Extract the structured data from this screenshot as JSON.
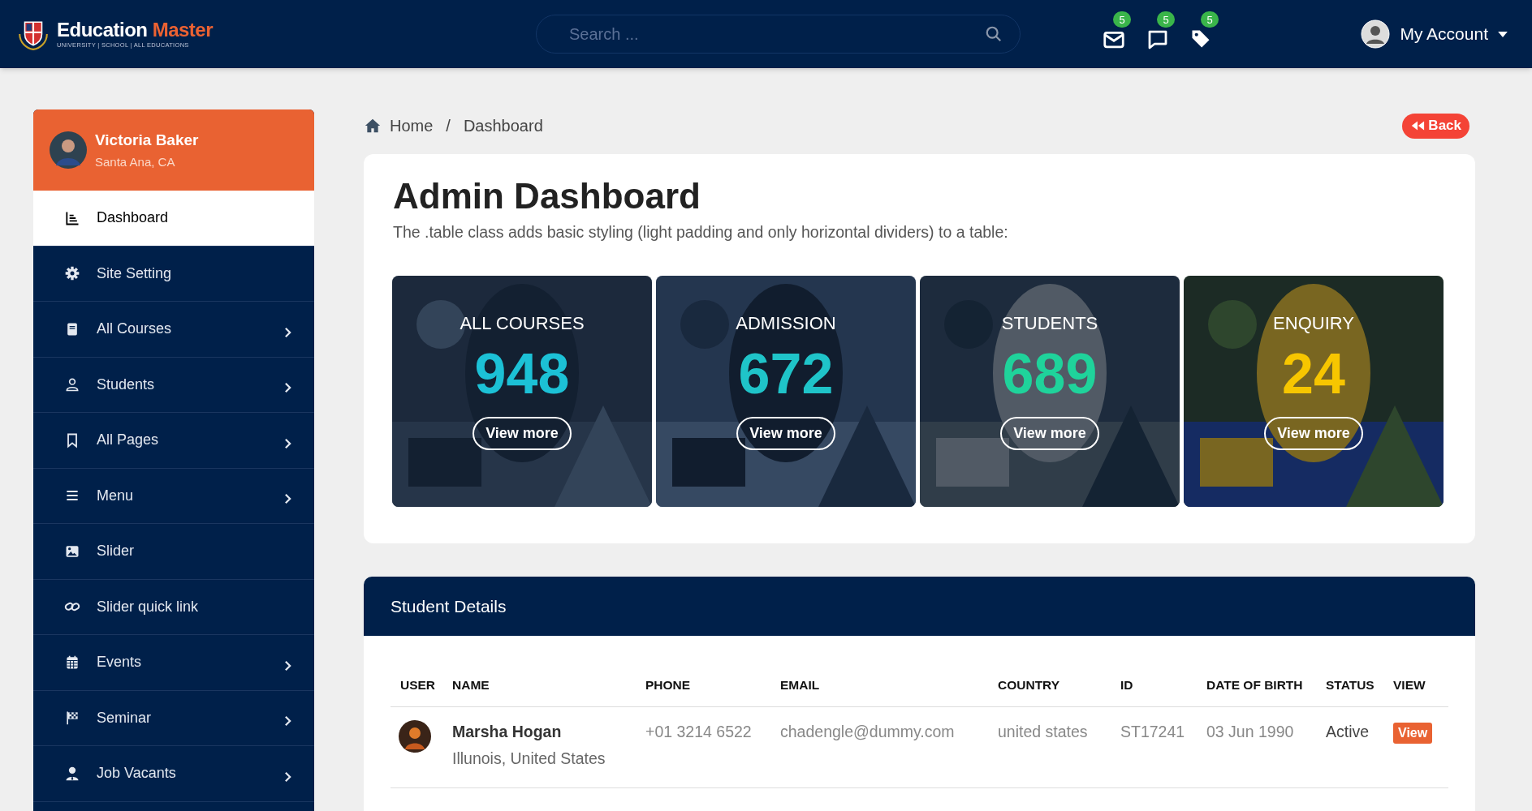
{
  "header": {
    "logo": {
      "name_part1": "Education",
      "name_part2": "Master",
      "tagline": "UNIVERSITY | SCHOOL | ALL EDUCATIONS"
    },
    "search": {
      "placeholder": "Search ..."
    },
    "notifications": [
      {
        "count": "5"
      },
      {
        "count": "5"
      },
      {
        "count": "5"
      }
    ],
    "account": {
      "label": "My Account"
    }
  },
  "sidebar": {
    "profile": {
      "name": "Victoria Baker",
      "location": "Santa Ana, CA"
    },
    "items": [
      {
        "label": "Dashboard",
        "selected": true,
        "has_children": false
      },
      {
        "label": "Site Setting",
        "selected": false,
        "has_children": false
      },
      {
        "label": "All Courses",
        "selected": false,
        "has_children": true
      },
      {
        "label": "Students",
        "selected": false,
        "has_children": true
      },
      {
        "label": "All Pages",
        "selected": false,
        "has_children": true
      },
      {
        "label": "Menu",
        "selected": false,
        "has_children": true
      },
      {
        "label": "Slider",
        "selected": false,
        "has_children": false
      },
      {
        "label": "Slider quick link",
        "selected": false,
        "has_children": false
      },
      {
        "label": "Events",
        "selected": false,
        "has_children": true
      },
      {
        "label": "Seminar",
        "selected": false,
        "has_children": true
      },
      {
        "label": "Job Vacants",
        "selected": false,
        "has_children": true
      }
    ]
  },
  "breadcrumb": {
    "items": [
      "Home",
      "Dashboard"
    ],
    "separator": "/"
  },
  "back_button": "Back",
  "dashboard": {
    "title": "Admin Dashboard",
    "subtitle": "The .table class adds basic styling (light padding and only horizontal dividers) to a table:",
    "stats": [
      {
        "title": "ALL COURSES",
        "value": "948",
        "color": "#1cc1d6",
        "link": "View more"
      },
      {
        "title": "ADMISSION",
        "value": "672",
        "color": "#1fc4c9",
        "link": "View more"
      },
      {
        "title": "STUDENTS",
        "value": "689",
        "color": "#1fd39b",
        "link": "View more"
      },
      {
        "title": "ENQUIRY",
        "value": "24",
        "color": "#f7c600",
        "link": "View more"
      }
    ]
  },
  "student_details": {
    "title": "Student Details",
    "columns": [
      "USER",
      "NAME",
      "PHONE",
      "EMAIL",
      "COUNTRY",
      "ID",
      "DATE OF BIRTH",
      "STATUS",
      "VIEW"
    ],
    "rows": [
      {
        "name": "Marsha Hogan",
        "address": "Illunois, United States",
        "phone": "+01 3214 6522",
        "email": "chadengle@dummy.com",
        "country": "united states",
        "id": "ST17241",
        "dob": "03 Jun 1990",
        "status": "Active",
        "view": "View"
      }
    ]
  }
}
